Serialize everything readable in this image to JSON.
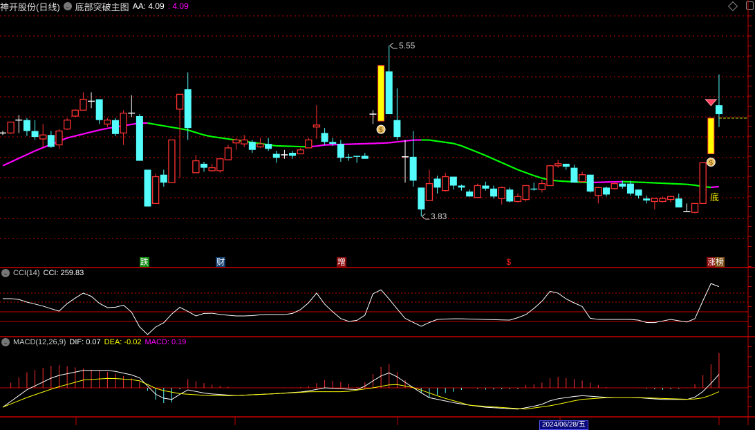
{
  "header": {
    "stock": "神开股份(日线)",
    "indicator": "底部突破主图",
    "aa_label": "AA: 4.09",
    "aa_value": ": 4.09"
  },
  "cci_header": {
    "title": "CCI(14)",
    "value": "CCI: 259.83"
  },
  "macd_header": {
    "title": "MACD(12,26,9)",
    "dif": "DIF: 0.07",
    "dea": "DEA: -0.02",
    "macd": "MACD: 0.19"
  },
  "annotations": {
    "high": "5.55",
    "low": "3.83",
    "bottom": "底"
  },
  "event_tags": [
    {
      "text": "跌",
      "bg": "#108a10",
      "index": 17.5
    },
    {
      "text": "财",
      "bg": "#103e6e",
      "index": 27
    },
    {
      "text": "增",
      "bg": "#8a0a0a",
      "index": 42
    },
    {
      "text": "$",
      "bg": "transparent",
      "index": 63
    },
    {
      "text": "涨",
      "bg": "#8a0a0a",
      "index": 88
    },
    {
      "text": "榜",
      "bg": "#7a4a10",
      "index": 89
    }
  ],
  "date_cursor": "2024/06/28/五",
  "colors": {
    "up": "#ff3232",
    "down": "#54fcfc",
    "doji": "#ffffff",
    "limit": "#ffff00",
    "ma_up": "#ff00ff",
    "ma_down": "#00ff00",
    "grid": "#c80000"
  },
  "price_axis": {
    "high": 5.55,
    "low": 3.83
  },
  "candles": [
    [
      4.67,
      4.67,
      4.69,
      4.65
    ],
    [
      4.67,
      4.78,
      4.78,
      4.66
    ],
    [
      4.8,
      4.8,
      4.85,
      4.67
    ],
    [
      4.8,
      4.69,
      4.82,
      4.64
    ],
    [
      4.69,
      4.63,
      4.8,
      4.6
    ],
    [
      4.61,
      4.65,
      4.76,
      4.53
    ],
    [
      4.65,
      4.53,
      4.69,
      4.52
    ],
    [
      4.55,
      4.69,
      4.71,
      4.51
    ],
    [
      4.71,
      4.8,
      4.82,
      4.7
    ],
    [
      4.84,
      4.9,
      4.91,
      4.83
    ],
    [
      4.9,
      5.01,
      5.08,
      4.9
    ],
    [
      4.99,
      4.99,
      5.08,
      4.92
    ],
    [
      5.01,
      4.8,
      5.01,
      4.76
    ],
    [
      4.76,
      4.8,
      4.82,
      4.73
    ],
    [
      4.8,
      4.66,
      4.82,
      4.64
    ],
    [
      4.67,
      4.87,
      4.9,
      4.55
    ],
    [
      4.87,
      4.87,
      5.05,
      4.83
    ],
    [
      4.84,
      4.39,
      4.86,
      4.39
    ],
    [
      4.3,
      3.93,
      4.3,
      3.93
    ],
    [
      3.96,
      4.23,
      4.26,
      3.96
    ],
    [
      4.25,
      4.17,
      4.3,
      4.13
    ],
    [
      4.17,
      4.6,
      4.6,
      4.17
    ],
    [
      4.91,
      5.06,
      5.06,
      4.22
    ],
    [
      5.11,
      4.72,
      5.28,
      4.6
    ],
    [
      4.27,
      4.39,
      4.45,
      4.27
    ],
    [
      4.36,
      4.32,
      4.38,
      4.28
    ],
    [
      4.29,
      4.32,
      4.36,
      4.28
    ],
    [
      4.29,
      4.41,
      4.41,
      4.27
    ],
    [
      4.4,
      4.52,
      4.55,
      4.4
    ],
    [
      4.57,
      4.6,
      4.62,
      4.5
    ],
    [
      4.56,
      4.6,
      4.65,
      4.53
    ],
    [
      4.58,
      4.5,
      4.6,
      4.47
    ],
    [
      4.53,
      4.56,
      4.62,
      4.52
    ],
    [
      4.56,
      4.51,
      4.62,
      4.49
    ],
    [
      4.46,
      4.42,
      4.49,
      4.37
    ],
    [
      4.45,
      4.45,
      4.5,
      4.41
    ],
    [
      4.47,
      4.44,
      4.49,
      4.41
    ],
    [
      4.46,
      4.5,
      4.52,
      4.46
    ],
    [
      4.52,
      4.6,
      4.62,
      4.52
    ],
    [
      4.73,
      4.75,
      4.95,
      4.61
    ],
    [
      4.67,
      4.58,
      4.72,
      4.55
    ],
    [
      4.58,
      4.56,
      4.62,
      4.54
    ],
    [
      4.56,
      4.42,
      4.6,
      4.38
    ],
    [
      4.43,
      4.42,
      4.46,
      4.39
    ],
    [
      4.44,
      4.43,
      4.44,
      4.37
    ],
    [
      4.44,
      4.41,
      4.47,
      4.41
    ],
    [
      4.86,
      4.86,
      4.9,
      4.76
    ],
    [
      4.79,
      5.35,
      5.35,
      4.79,
      1
    ],
    [
      5.29,
      4.86,
      5.55,
      4.86
    ],
    [
      4.8,
      4.63,
      5.12,
      4.6
    ],
    [
      4.43,
      4.43,
      4.6,
      4.17
    ],
    [
      4.43,
      4.19,
      4.69,
      4.13
    ],
    [
      4.12,
      3.9,
      4.12,
      3.83
    ],
    [
      3.99,
      4.16,
      4.3,
      3.99
    ],
    [
      4.21,
      4.12,
      4.24,
      4.06
    ],
    [
      4.09,
      4.23,
      4.27,
      4.08
    ],
    [
      4.23,
      4.14,
      4.23,
      4.1
    ],
    [
      4.14,
      4.12,
      4.15,
      4.09
    ],
    [
      4.08,
      4.03,
      4.1,
      4.03
    ],
    [
      4.02,
      4.14,
      4.16,
      4.02
    ],
    [
      4.14,
      4.11,
      4.18,
      4.09
    ],
    [
      4.11,
      4.03,
      4.14,
      4.01
    ],
    [
      4.01,
      4.12,
      4.13,
      3.95
    ],
    [
      4.1,
      3.98,
      4.12,
      3.97
    ],
    [
      3.98,
      4.03,
      4.06,
      3.97
    ],
    [
      4.0,
      4.14,
      4.14,
      3.98
    ],
    [
      4.11,
      4.1,
      4.17,
      4.09
    ],
    [
      4.1,
      4.16,
      4.2,
      4.07
    ],
    [
      4.14,
      4.34,
      4.35,
      4.14
    ],
    [
      4.34,
      4.36,
      4.4,
      4.32
    ],
    [
      4.36,
      4.33,
      4.36,
      4.3
    ],
    [
      4.32,
      4.17,
      4.35,
      4.17
    ],
    [
      4.18,
      4.25,
      4.28,
      4.17
    ],
    [
      4.25,
      4.08,
      4.25,
      4.07
    ],
    [
      4.04,
      4.12,
      4.13,
      3.96
    ],
    [
      4.12,
      4.05,
      4.13,
      4.03
    ],
    [
      4.11,
      4.16,
      4.18,
      4.1
    ],
    [
      4.16,
      4.13,
      4.19,
      4.11
    ],
    [
      4.16,
      4.06,
      4.19,
      4.04
    ],
    [
      4.1,
      4.04,
      4.1,
      4.01
    ],
    [
      4.01,
      3.99,
      4.04,
      3.96
    ],
    [
      3.98,
      4.01,
      4.01,
      3.9
    ],
    [
      3.98,
      4.01,
      4.03,
      3.97
    ],
    [
      4.0,
      4.03,
      4.04,
      3.97
    ],
    [
      4.01,
      3.92,
      4.06,
      3.92
    ],
    [
      3.88,
      3.88,
      3.96,
      3.88
    ],
    [
      3.87,
      3.96,
      3.96,
      3.86
    ],
    [
      3.96,
      4.37,
      4.37,
      3.96
    ],
    [
      4.46,
      4.82,
      4.82,
      4.46,
      1
    ],
    [
      4.95,
      4.86,
      5.26,
      4.73
    ]
  ],
  "ma_knots": [
    [
      0,
      4.34
    ],
    [
      4,
      4.49
    ],
    [
      8,
      4.62
    ],
    [
      12.5,
      4.71
    ],
    [
      17,
      4.77
    ],
    [
      18,
      4.77
    ],
    [
      19.4,
      4.75
    ],
    [
      23,
      4.7
    ],
    [
      25.4,
      4.64
    ],
    [
      29.7,
      4.59
    ],
    [
      34,
      4.54
    ],
    [
      38.3,
      4.53
    ],
    [
      40,
      4.55
    ],
    [
      44.3,
      4.56
    ],
    [
      47.8,
      4.57
    ],
    [
      51.2,
      4.6
    ],
    [
      52.9,
      4.6
    ],
    [
      56.4,
      4.56
    ],
    [
      59.8,
      4.45
    ],
    [
      64,
      4.3
    ],
    [
      66.7,
      4.22
    ],
    [
      68.4,
      4.19
    ],
    [
      72.7,
      4.17
    ],
    [
      77,
      4.18
    ],
    [
      80.4,
      4.17
    ],
    [
      85.6,
      4.15
    ],
    [
      87.7,
      4.12
    ],
    [
      89,
      4.13
    ]
  ],
  "cci_knots": [
    [
      0,
      136
    ],
    [
      1.7,
      136
    ],
    [
      3,
      100
    ],
    [
      4.8,
      64
    ],
    [
      6.1,
      29
    ],
    [
      7,
      7
    ],
    [
      8.2,
      100
    ],
    [
      10,
      193
    ],
    [
      11.3,
      150
    ],
    [
      12.5,
      43
    ],
    [
      13.8,
      43
    ],
    [
      15.5,
      79
    ],
    [
      16.8,
      -136
    ],
    [
      17.9,
      -243
    ],
    [
      19,
      -157
    ],
    [
      20.3,
      -100
    ],
    [
      21.6,
      43
    ],
    [
      22.4,
      50
    ],
    [
      23.7,
      -50
    ],
    [
      25.4,
      -7
    ],
    [
      27.1,
      -29
    ],
    [
      28.9,
      -43
    ],
    [
      30.6,
      -43
    ],
    [
      32.3,
      -29
    ],
    [
      34,
      -29
    ],
    [
      35.7,
      -29
    ],
    [
      37.5,
      43
    ],
    [
      39,
      193
    ],
    [
      40,
      79
    ],
    [
      41.8,
      -64
    ],
    [
      43,
      -100
    ],
    [
      44.8,
      -79
    ],
    [
      46,
      186
    ],
    [
      46.9,
      236
    ],
    [
      48.2,
      114
    ],
    [
      49.9,
      -64
    ],
    [
      52,
      -150
    ],
    [
      53.8,
      -79
    ],
    [
      56.4,
      -71
    ],
    [
      59.8,
      -79
    ],
    [
      63.2,
      -86
    ],
    [
      65,
      -29
    ],
    [
      66.7,
      79
    ],
    [
      68.1,
      221
    ],
    [
      69.2,
      186
    ],
    [
      70.5,
      100
    ],
    [
      71.8,
      79
    ],
    [
      73.1,
      -79
    ],
    [
      75.3,
      -79
    ],
    [
      78.7,
      -79
    ],
    [
      80.4,
      -121
    ],
    [
      83,
      -79
    ],
    [
      85.6,
      -114
    ],
    [
      86.4,
      -29
    ],
    [
      87.3,
      186
    ],
    [
      88.1,
      307
    ],
    [
      89,
      259.83
    ]
  ],
  "dif_knots": [
    [
      0,
      -0.1
    ],
    [
      3,
      -0.01
    ],
    [
      6.5,
      0.06
    ],
    [
      10,
      0.09
    ],
    [
      13.4,
      0.09
    ],
    [
      16.8,
      0.06
    ],
    [
      19.4,
      -0.05
    ],
    [
      21,
      -0.06
    ],
    [
      22.9,
      -0.01
    ],
    [
      25.4,
      -0.03
    ],
    [
      28.9,
      -0.04
    ],
    [
      34,
      -0.03
    ],
    [
      37.5,
      -0.02
    ],
    [
      40,
      0.0
    ],
    [
      44.3,
      -0.01
    ],
    [
      46.9,
      0.06
    ],
    [
      48.2,
      0.08
    ],
    [
      50.3,
      0.02
    ],
    [
      52.9,
      -0.05
    ],
    [
      56.4,
      -0.08
    ],
    [
      59.8,
      -0.1
    ],
    [
      64,
      -0.11
    ],
    [
      66.7,
      -0.09
    ],
    [
      68.4,
      -0.06
    ],
    [
      71.8,
      -0.04
    ],
    [
      75.3,
      -0.05
    ],
    [
      78.7,
      -0.05
    ],
    [
      82,
      -0.06
    ],
    [
      85.6,
      -0.06
    ],
    [
      87.3,
      -0.01
    ],
    [
      89,
      0.07
    ]
  ],
  "dea_knots": [
    [
      0,
      -0.1
    ],
    [
      3,
      -0.05
    ],
    [
      6.5,
      0.0
    ],
    [
      10,
      0.04
    ],
    [
      13.4,
      0.05
    ],
    [
      16.8,
      0.04
    ],
    [
      19.4,
      -0.01
    ],
    [
      22,
      -0.03
    ],
    [
      25.4,
      -0.04
    ],
    [
      28.9,
      -0.04
    ],
    [
      34,
      -0.03
    ],
    [
      38.3,
      -0.02
    ],
    [
      42.6,
      -0.02
    ],
    [
      46,
      0.0
    ],
    [
      48.6,
      0.02
    ],
    [
      51.2,
      0.0
    ],
    [
      54.6,
      -0.05
    ],
    [
      58,
      -0.09
    ],
    [
      61.5,
      -0.1
    ],
    [
      65,
      -0.11
    ],
    [
      68.4,
      -0.09
    ],
    [
      71.8,
      -0.06
    ],
    [
      75.3,
      -0.05
    ],
    [
      78.7,
      -0.05
    ],
    [
      85.6,
      -0.06
    ],
    [
      87.3,
      -0.05
    ],
    [
      89,
      -0.02
    ]
  ]
}
